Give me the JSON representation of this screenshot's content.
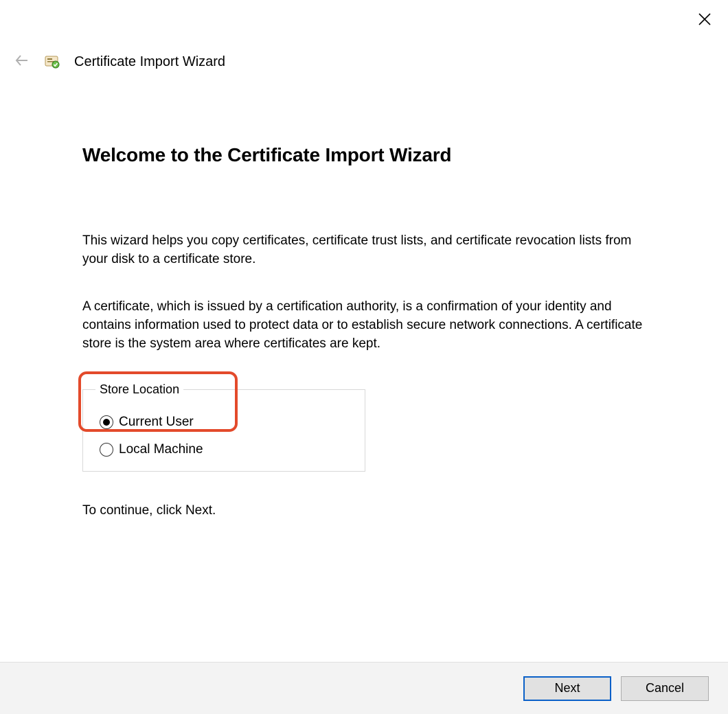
{
  "header": {
    "title": "Certificate Import Wizard"
  },
  "main": {
    "welcome_title": "Welcome to the Certificate Import Wizard",
    "intro_text": "This wizard helps you copy certificates, certificate trust lists, and certificate revocation lists from your disk to a certificate store.",
    "description_text": "A certificate, which is issued by a certification authority, is a confirmation of your identity and contains information used to protect data or to establish secure network connections. A certificate store is the system area where certificates are kept.",
    "store_location": {
      "legend": "Store Location",
      "options": [
        {
          "label": "Current User",
          "checked": true
        },
        {
          "label": "Local Machine",
          "checked": false
        }
      ]
    },
    "continue_text": "To continue, click Next."
  },
  "footer": {
    "next_label": "Next",
    "cancel_label": "Cancel"
  },
  "annotation": {
    "highlight_target": "current-user-option",
    "highlight_color": "#e34a2b"
  }
}
